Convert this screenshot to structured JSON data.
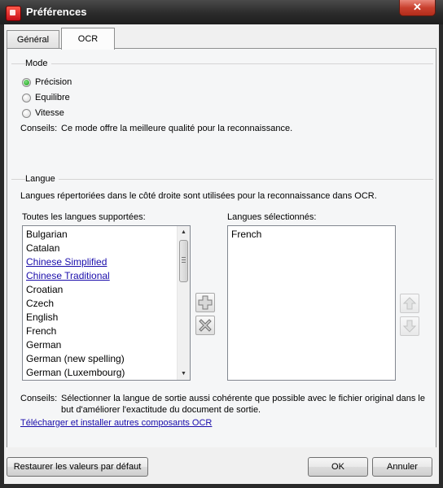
{
  "window": {
    "title": "Préférences",
    "close_label": "✕"
  },
  "tabs": [
    {
      "label": "Général"
    },
    {
      "label": "OCR"
    }
  ],
  "mode": {
    "legend": "Mode",
    "options": [
      {
        "label": "Précision",
        "checked": true
      },
      {
        "label": "Equilibre",
        "checked": false
      },
      {
        "label": "Vitesse",
        "checked": false
      }
    ],
    "hint_label": "Conseils:",
    "hint_text": "Ce mode offre la meilleure qualité pour la reconnaissance."
  },
  "langue": {
    "legend": "Langue",
    "description": "Langues répertoriées dans le côté droite sont utilisées pour la reconnaissance dans OCR.",
    "all_label": "Toutes les langues supportées:",
    "selected_label": "Langues sélectionnés:",
    "all_languages": [
      {
        "name": "Bulgarian",
        "link": false
      },
      {
        "name": "Catalan",
        "link": false
      },
      {
        "name": "Chinese Simplified",
        "link": true
      },
      {
        "name": "Chinese Traditional",
        "link": true
      },
      {
        "name": "Croatian",
        "link": false
      },
      {
        "name": "Czech",
        "link": false
      },
      {
        "name": "English",
        "link": false
      },
      {
        "name": "French",
        "link": false
      },
      {
        "name": "German",
        "link": false
      },
      {
        "name": "German (new spelling)",
        "link": false
      },
      {
        "name": "German (Luxembourg)",
        "link": false
      }
    ],
    "selected_languages": [
      "French"
    ],
    "hint_label": "Conseils:",
    "hint_line1": "Sélectionner la langue de sortie aussi cohérente que possible avec le fichier original dans le",
    "hint_line2": "but d'améliorer l'exactitude du document de sortie.",
    "download_link": "Télécharger et installer autres composants OCR"
  },
  "buttons": {
    "restore": "Restaurer les valeurs par défaut",
    "ok": "OK",
    "cancel": "Annuler"
  }
}
